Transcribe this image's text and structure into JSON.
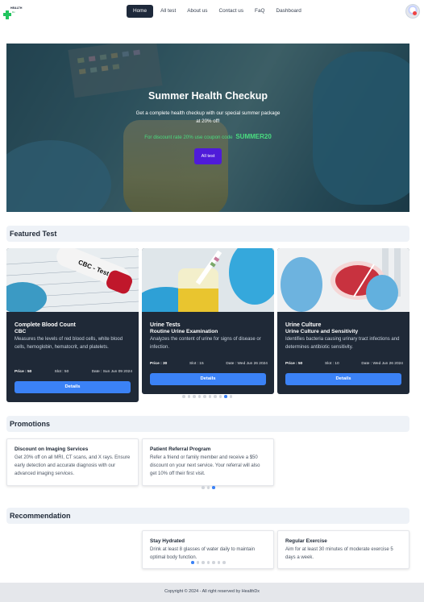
{
  "brand": {
    "logo_text": "HEALTH",
    "logo_sub": "Dx"
  },
  "nav": {
    "items": [
      "Home",
      "All test",
      "About us",
      "Contact us",
      "FaQ",
      "Dashboard"
    ],
    "active": "Home"
  },
  "hero": {
    "title": "Summer Health Checkup",
    "description": "Get a complete health checkup with our special summer package at 20% off!",
    "coupon_text": "For discount rate 20% use coupon code",
    "coupon_code": "SUMMER20",
    "button": "All test"
  },
  "featured": {
    "heading": "Featured Test",
    "cards": [
      {
        "image_label": "CBC - Test",
        "title": "Complete Blood Count",
        "subtitle": "CBC",
        "description": "Measures the levels of red blood cells, white blood cells, hemoglobin, hematocrit, and platelets.",
        "price": "Price : 50",
        "slot": "Slot : 50",
        "date": "Date : Sun Jun 09 2024",
        "button": "Details"
      },
      {
        "title": "Urine Tests",
        "subtitle": "Routine Urine Examination",
        "description": "Analyzes the content of urine for signs of disease or infection.",
        "price": "Price : 30",
        "slot": "Slot : 15",
        "date": "Date : Wed Jun 26 2024",
        "button": "Details"
      },
      {
        "title": "Urine Culture",
        "subtitle": "Urine Culture and Sensitivity",
        "description": "Identifies bacteria causing urinary tract infections and determines antibiotic sensitivity.",
        "price": "Price : 50",
        "slot": "Slot : 10",
        "date": "Date : Wed Jun 26 2024",
        "button": "Details"
      }
    ],
    "pagination": {
      "count": 10,
      "active": 9
    }
  },
  "promotions": {
    "heading": "Promotions",
    "cards": [
      {
        "title": "Discount on Imaging Services",
        "text": "Get 20% off on all MRI, CT scans, and X rays. Ensure early detection and accurate diagnosis with our advanced imaging services."
      },
      {
        "title": "Patient Referral Program",
        "text": "Refer a friend or family member and receive a $50 discount on your next service. Your referral will also get 10% off their first visit."
      }
    ],
    "pagination": {
      "count": 3,
      "active": 3
    }
  },
  "recommendation": {
    "heading": "Recommendation",
    "cards": [
      {
        "title": "Stay Hydrated",
        "text": "Drink at least 8 glasses of water daily to maintain optimal body function."
      },
      {
        "title": "Regular Exercise",
        "text": "Aim for at least 30 minutes of moderate exercise 5 days a week."
      }
    ],
    "pagination": {
      "count": 7,
      "active": 1
    }
  },
  "footer": {
    "text": "Copyright © 2024 - All right reserved by HealthDx"
  },
  "colors": {
    "nav_active_bg": "#1e293b",
    "hero_button": "#4f1bd9",
    "coupon_green": "#4ade80",
    "card_bg": "#1f2937",
    "details_button": "#3b82f6",
    "section_header_bg": "#eef2f7"
  }
}
